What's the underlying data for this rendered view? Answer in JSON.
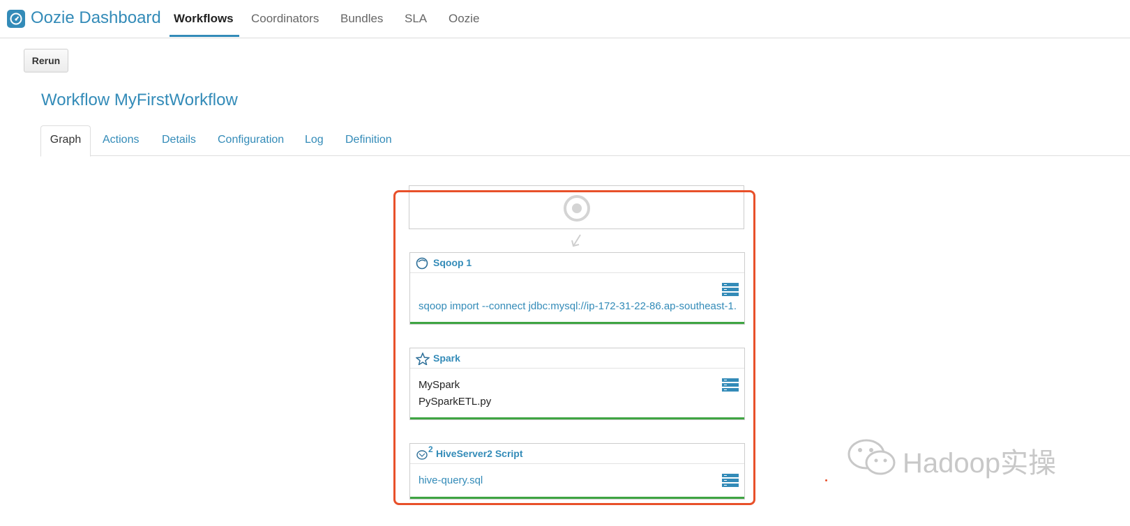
{
  "app": {
    "brand": "Oozie Dashboard"
  },
  "nav": {
    "items": [
      {
        "label": "Workflows",
        "active": true
      },
      {
        "label": "Coordinators",
        "active": false
      },
      {
        "label": "Bundles",
        "active": false
      },
      {
        "label": "SLA",
        "active": false
      },
      {
        "label": "Oozie",
        "active": false
      }
    ]
  },
  "toolbar": {
    "rerun_label": "Rerun"
  },
  "workflow": {
    "title": "Workflow MyFirstWorkflow"
  },
  "tabs": [
    {
      "label": "Graph",
      "active": true
    },
    {
      "label": "Actions",
      "active": false
    },
    {
      "label": "Details",
      "active": false
    },
    {
      "label": "Configuration",
      "active": false
    },
    {
      "label": "Log",
      "active": false
    },
    {
      "label": "Definition",
      "active": false
    }
  ],
  "graph": {
    "nodes": [
      {
        "title": "Sqoop 1",
        "icon": "sqoop-icon",
        "line1": "sqoop import --connect jdbc:mysql://ip-172-31-22-86.ap-southeast-1.",
        "status_color": "#3fa543"
      },
      {
        "title": "Spark",
        "icon": "spark-icon",
        "line1": "MySpark",
        "line2": "PySparkETL.py",
        "status_color": "#3fa543"
      },
      {
        "title": "HiveServer2 Script",
        "icon": "hive-icon",
        "superscript": "2",
        "line1": "hive-query.sql",
        "status_color": "#3fa543"
      }
    ]
  },
  "watermark": {
    "text": "Hadoop实操"
  },
  "colors": {
    "accent": "#338bb8",
    "highlight": "#e8502a",
    "success": "#3fa543"
  }
}
